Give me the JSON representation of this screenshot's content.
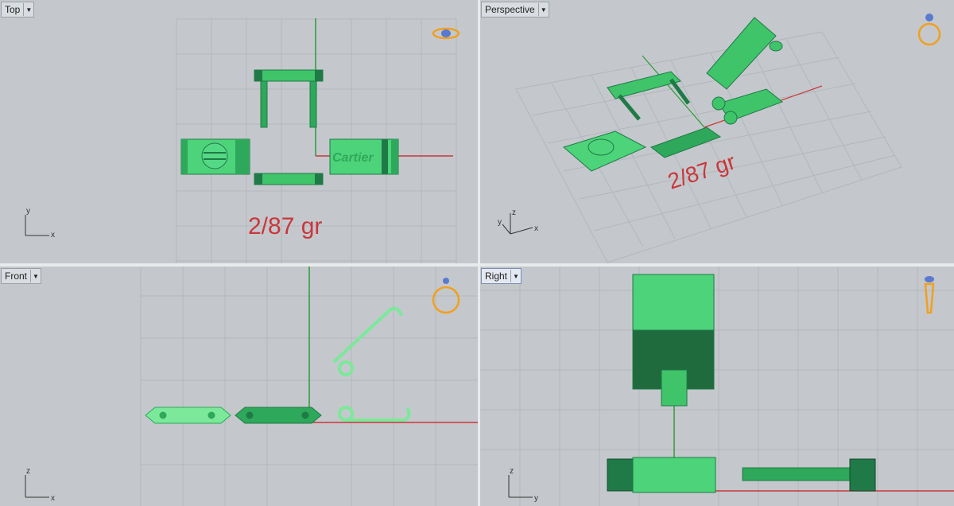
{
  "viewports": {
    "top": {
      "label": "Top",
      "weight": "2/87 gr",
      "engraving": "Cartier",
      "axis_x": "x",
      "axis_y": "y"
    },
    "perspective": {
      "label": "Perspective",
      "weight": "2/87 gr",
      "axis_x": "x",
      "axis_y": "y",
      "axis_z": "z"
    },
    "front": {
      "label": "Front",
      "axis_x": "x",
      "axis_z": "z"
    },
    "right": {
      "label": "Right",
      "axis_y": "y",
      "axis_z": "z"
    }
  },
  "colors": {
    "part_green": "#3fc46a",
    "part_dark": "#1f7a47",
    "axis_red": "#c8373b",
    "axis_green": "#2d9a3a",
    "gizmo": "#f0a020"
  },
  "icons": [
    "dropdown-arrow-icon",
    "ring-gizmo-icon"
  ]
}
